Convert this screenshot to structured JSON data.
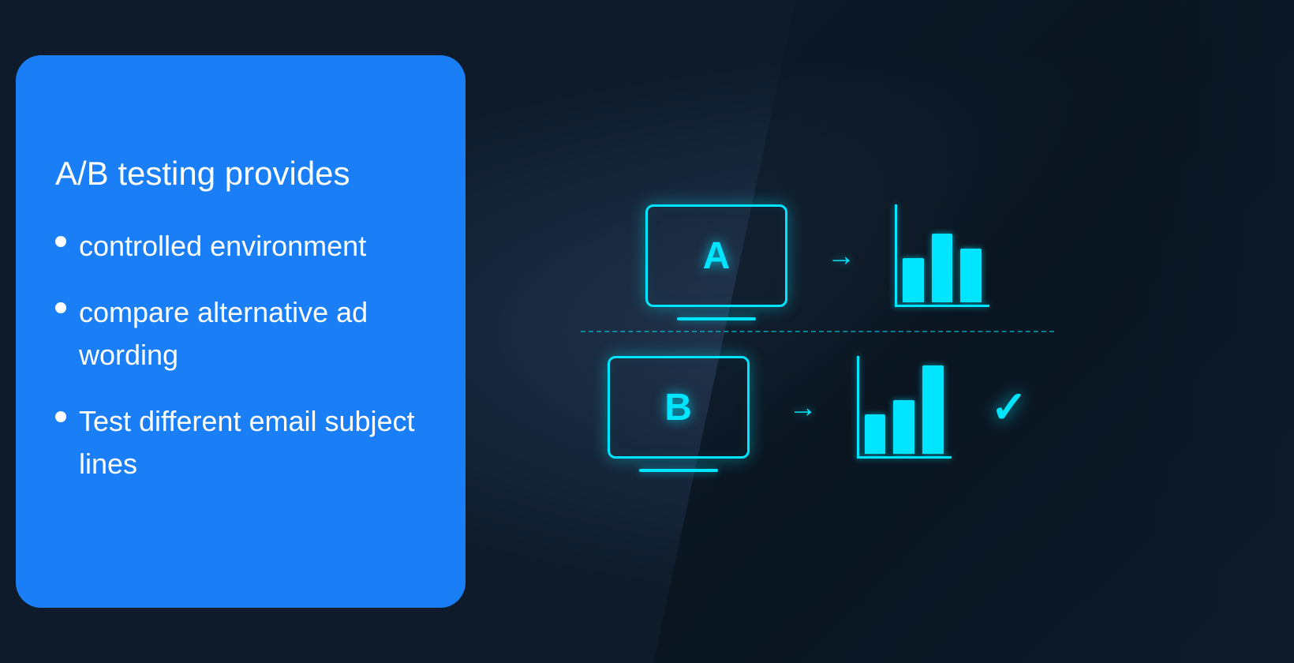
{
  "left_panel": {
    "heading": "A/B testing provides",
    "items": [
      {
        "text": "controlled environment"
      },
      {
        "text": "compare alternative ad wording"
      },
      {
        "text": "Test different email subject lines"
      }
    ]
  },
  "diagram": {
    "version_a_label": "A",
    "version_b_label": "B",
    "arrow_symbol": "→",
    "checkmark_symbol": "✓"
  },
  "colors": {
    "accent_cyan": "#00e5ff",
    "panel_blue": "#1a7ef7",
    "bg_dark": "#0d1b2a"
  }
}
